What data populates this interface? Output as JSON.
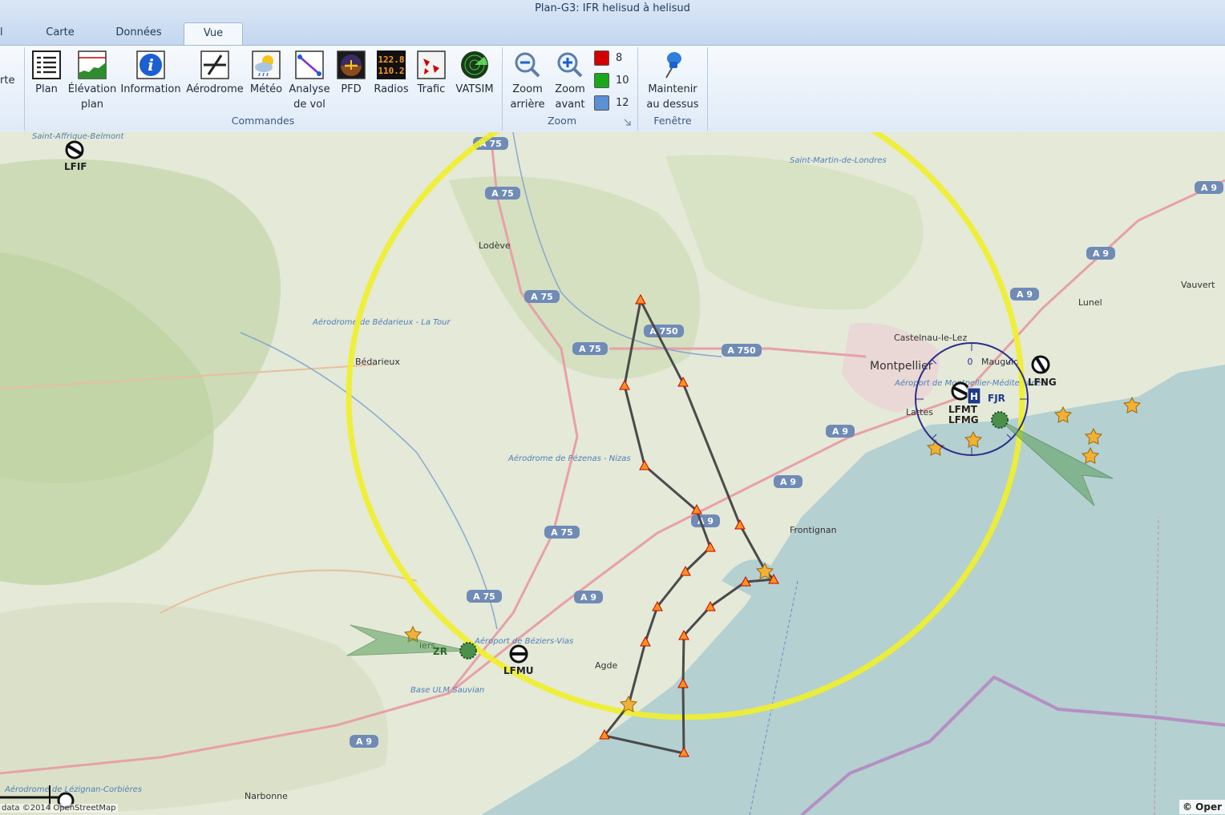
{
  "window": {
    "title": "Plan-G3: IFR helisud à helisud"
  },
  "tabs": {
    "prev": "l",
    "carte": "Carte",
    "donnees": "Données",
    "vue": "Vue"
  },
  "ribbon": {
    "prev_label": "rte",
    "commandes": {
      "label": "Commandes",
      "plan": "Plan",
      "elevation": [
        "Élévation",
        "plan"
      ],
      "information": "Information",
      "aerodrome": "Aérodrome",
      "meteo": "Météo",
      "analyse": [
        "Analyse",
        "de vol"
      ],
      "pfd": "PFD",
      "radios": "Radios",
      "radios_freq_1": "122.8",
      "radios_freq_2": "110.2",
      "trafic": "Trafic",
      "vatsim": "VATSIM"
    },
    "zoom": {
      "label": "Zoom",
      "zoom_out": [
        "Zoom",
        "arrière"
      ],
      "zoom_in": [
        "Zoom",
        "avant"
      ],
      "levels": [
        {
          "value": "8",
          "color": "#d40000"
        },
        {
          "value": "10",
          "color": "#1aa81a"
        },
        {
          "value": "12",
          "color": "#5b8fd6"
        }
      ]
    },
    "fenetre": {
      "label": "Fenêtre",
      "maintenir": [
        "Maintenir",
        "au dessus"
      ]
    }
  },
  "map": {
    "places": {
      "lodeve": "Lodève",
      "bedarieux": "Bédarieux",
      "montpellier": "Montpellier",
      "castelnau": "Castelnau-le-Lez",
      "lunel": "Lunel",
      "vauvert": "Vauvert",
      "frontignan": "Frontignan",
      "agde": "Agde",
      "narbonne": "Narbonne",
      "mauguio": "Mauguio",
      "lattes": "Lattes",
      "beziers_partial": "iers"
    },
    "aerodromes": {
      "bedarieux_latour": "Aérodrome de Bédarieux - La Tour",
      "pezenas": "Aérodrome de Pézenas - Nizas",
      "beziers_vias": "Aéroport de Béziers-Vias",
      "sauvian": "Base ULM Sauvian",
      "montpellier_med": "Aéroport de Montpellier-Méditerranée",
      "lezignan": "Aérodrome de Lézignan-Corbières",
      "st_martin": "Saint-Martin-de-Londres",
      "top_left_partial": "Saint-Affrique-Belmont"
    },
    "icao": {
      "lfif": "LFIF",
      "lfng": "LFNG",
      "lfmu": "LFMU",
      "lfmt": "LFMT",
      "lfmg": "LFMG"
    },
    "traffic": {
      "fjr": "FJR",
      "zr": "ZR"
    },
    "compass_zero": "0",
    "roads": {
      "a75": "A 75",
      "a750": "A 750",
      "a9": "A 9"
    },
    "attribution_left": "data ©2014 OpenStreetMap",
    "attribution_right": "© Oper",
    "colors": {
      "range_ring": "#f0ef2a",
      "route": "#444444",
      "sea": "#b4d0d1",
      "land": "#e4e9d8"
    }
  }
}
